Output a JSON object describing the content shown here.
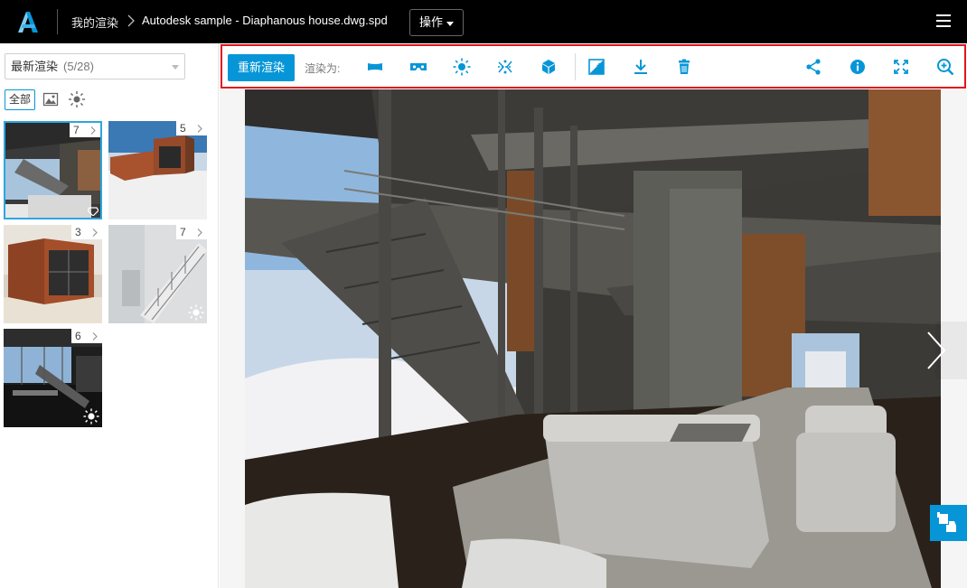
{
  "header": {
    "breadcrumb_root": "我的渲染",
    "file_name": "Autodesk sample - Diaphanous house.dwg.spd",
    "actions_label": "操作",
    "icons": [
      "autodesk-logo-icon",
      "chevron-right-icon",
      "caret-down-icon",
      "hamburger-menu-icon"
    ]
  },
  "sidebar": {
    "filter_select": {
      "label": "最新渲染",
      "count": "(5/28)"
    },
    "filter_all_label": "全部",
    "thumbnails": [
      {
        "count": "7",
        "selected": true,
        "icon": "diamond-icon"
      },
      {
        "count": "5",
        "selected": false,
        "icon": ""
      },
      {
        "count": "3",
        "selected": false,
        "icon": ""
      },
      {
        "count": "7",
        "selected": false,
        "icon": "sun-icon"
      },
      {
        "count": "6",
        "selected": false,
        "icon": "sun-icon"
      }
    ]
  },
  "toolbar": {
    "rerender_label": "重新渲染",
    "render_as_label": "渲染为:",
    "render_as_icons": [
      "panorama-icon",
      "stereo-goggles-icon",
      "sun-study-icon",
      "illuminance-icon",
      "cube-icon"
    ],
    "action_icons": [
      "adjust-exposure-icon",
      "download-icon",
      "delete-icon"
    ],
    "right_icons": [
      "share-icon",
      "info-icon",
      "fullscreen-icon",
      "zoom-in-icon"
    ],
    "accent_color": "#0696d7",
    "highlight_color": "#e2151c"
  },
  "viewer": {
    "next_icon": "chevron-right-icon",
    "feedback_icon": "thumbs-feedback-icon"
  }
}
